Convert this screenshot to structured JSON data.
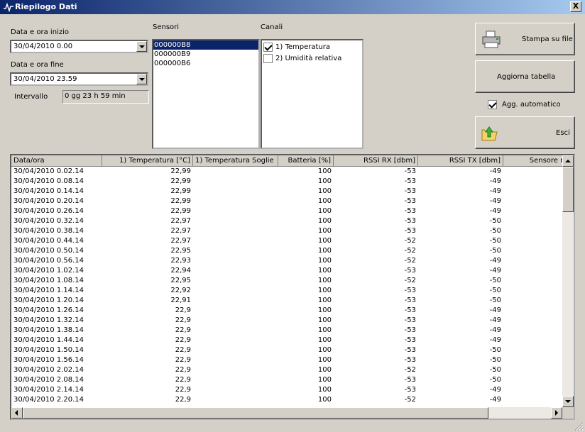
{
  "window": {
    "title": "Riepilogo Dati",
    "close_label": "X"
  },
  "filters": {
    "start_label": "Data e ora inizio",
    "start_value": "30/04/2010   0.00",
    "end_label": "Data e ora fine",
    "end_value": "30/04/2010 23.59",
    "interval_label": "Intervallo",
    "interval_value": "0 gg 23 h 59 min"
  },
  "sensors": {
    "label": "Sensori",
    "items": [
      "000000B8",
      "000000B9",
      "000000B6"
    ],
    "selected": "000000B8"
  },
  "channels": {
    "label": "Canali",
    "items": [
      {
        "label": "1) Temperatura",
        "checked": true
      },
      {
        "label": "2) Umidità relativa",
        "checked": false
      }
    ]
  },
  "buttons": {
    "print": "Stampa su file",
    "refresh": "Aggiorna tabella",
    "auto_update": "Agg. automatico",
    "auto_update_checked": true,
    "exit": "Esci"
  },
  "table": {
    "columns": [
      "Data/ora",
      "1) Temperatura [°C]",
      "1) Temperatura Soglie",
      "Batteria [%]",
      "RSSI RX [dbm]",
      "RSSI TX [dbm]",
      "Sensore ma"
    ],
    "rows": [
      [
        "30/04/2010 0.02.14",
        "22,99",
        "",
        "100",
        "-53",
        "-49",
        ""
      ],
      [
        "30/04/2010 0.08.14",
        "22,99",
        "",
        "100",
        "-53",
        "-49",
        ""
      ],
      [
        "30/04/2010 0.14.14",
        "22,99",
        "",
        "100",
        "-53",
        "-49",
        ""
      ],
      [
        "30/04/2010 0.20.14",
        "22,99",
        "",
        "100",
        "-53",
        "-49",
        ""
      ],
      [
        "30/04/2010 0.26.14",
        "22,99",
        "",
        "100",
        "-53",
        "-49",
        ""
      ],
      [
        "30/04/2010 0.32.14",
        "22,97",
        "",
        "100",
        "-53",
        "-50",
        ""
      ],
      [
        "30/04/2010 0.38.14",
        "22,97",
        "",
        "100",
        "-53",
        "-50",
        ""
      ],
      [
        "30/04/2010 0.44.14",
        "22,97",
        "",
        "100",
        "-52",
        "-50",
        ""
      ],
      [
        "30/04/2010 0.50.14",
        "22,95",
        "",
        "100",
        "-52",
        "-50",
        ""
      ],
      [
        "30/04/2010 0.56.14",
        "22,93",
        "",
        "100",
        "-52",
        "-49",
        ""
      ],
      [
        "30/04/2010 1.02.14",
        "22,94",
        "",
        "100",
        "-53",
        "-49",
        ""
      ],
      [
        "30/04/2010 1.08.14",
        "22,95",
        "",
        "100",
        "-52",
        "-50",
        ""
      ],
      [
        "30/04/2010 1.14.14",
        "22,92",
        "",
        "100",
        "-53",
        "-50",
        ""
      ],
      [
        "30/04/2010 1.20.14",
        "22,91",
        "",
        "100",
        "-53",
        "-50",
        ""
      ],
      [
        "30/04/2010 1.26.14",
        "22,9",
        "",
        "100",
        "-53",
        "-49",
        ""
      ],
      [
        "30/04/2010 1.32.14",
        "22,9",
        "",
        "100",
        "-53",
        "-49",
        ""
      ],
      [
        "30/04/2010 1.38.14",
        "22,9",
        "",
        "100",
        "-53",
        "-49",
        ""
      ],
      [
        "30/04/2010 1.44.14",
        "22,9",
        "",
        "100",
        "-53",
        "-49",
        ""
      ],
      [
        "30/04/2010 1.50.14",
        "22,9",
        "",
        "100",
        "-53",
        "-50",
        ""
      ],
      [
        "30/04/2010 1.56.14",
        "22,9",
        "",
        "100",
        "-53",
        "-50",
        ""
      ],
      [
        "30/04/2010 2.02.14",
        "22,9",
        "",
        "100",
        "-52",
        "-50",
        ""
      ],
      [
        "30/04/2010 2.08.14",
        "22,9",
        "",
        "100",
        "-53",
        "-50",
        ""
      ],
      [
        "30/04/2010 2.14.14",
        "22,9",
        "",
        "100",
        "-53",
        "-49",
        ""
      ],
      [
        "30/04/2010 2.20.14",
        "22,9",
        "",
        "100",
        "-52",
        "-49",
        ""
      ]
    ]
  },
  "colors": {
    "title_start": "#0a246a",
    "title_end": "#a6caf0",
    "selection": "#0a246a",
    "face": "#d4d0c8"
  }
}
